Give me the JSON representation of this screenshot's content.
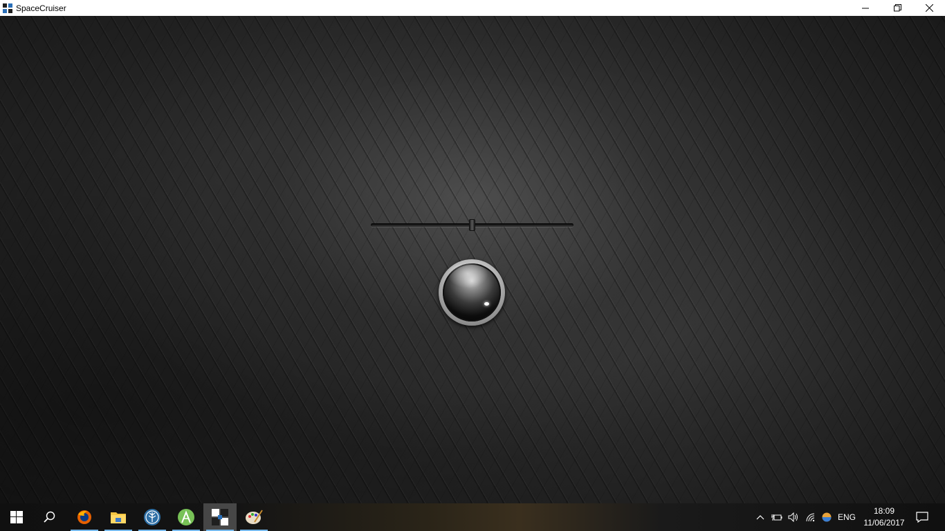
{
  "window": {
    "title": "SpaceCruiser",
    "app_icon": "spacecruiser-icon",
    "controls": [
      "minimize-icon",
      "restore-icon",
      "close-icon"
    ]
  },
  "app": {
    "slider": {
      "value_fraction": 0.5
    },
    "orb_button": {
      "icon": "orb-button"
    }
  },
  "taskbar": {
    "pinned": [
      {
        "name": "start",
        "icon": "windows-icon",
        "active": false
      },
      {
        "name": "search",
        "icon": "search-icon",
        "active": false
      },
      {
        "name": "firefox",
        "icon": "firefox-icon",
        "active": false
      },
      {
        "name": "file-explorer",
        "icon": "folder-icon",
        "active": false
      },
      {
        "name": "app-tree",
        "icon": "tree-icon",
        "active": false
      },
      {
        "name": "android-studio",
        "icon": "android-icon",
        "active": false
      },
      {
        "name": "spacecruiser",
        "icon": "spacecruiser-icon",
        "active": true
      },
      {
        "name": "paint",
        "icon": "palette-icon",
        "active": false
      }
    ],
    "tray": {
      "language": "ENG",
      "time": "18:09",
      "date": "11/06/2017"
    }
  }
}
